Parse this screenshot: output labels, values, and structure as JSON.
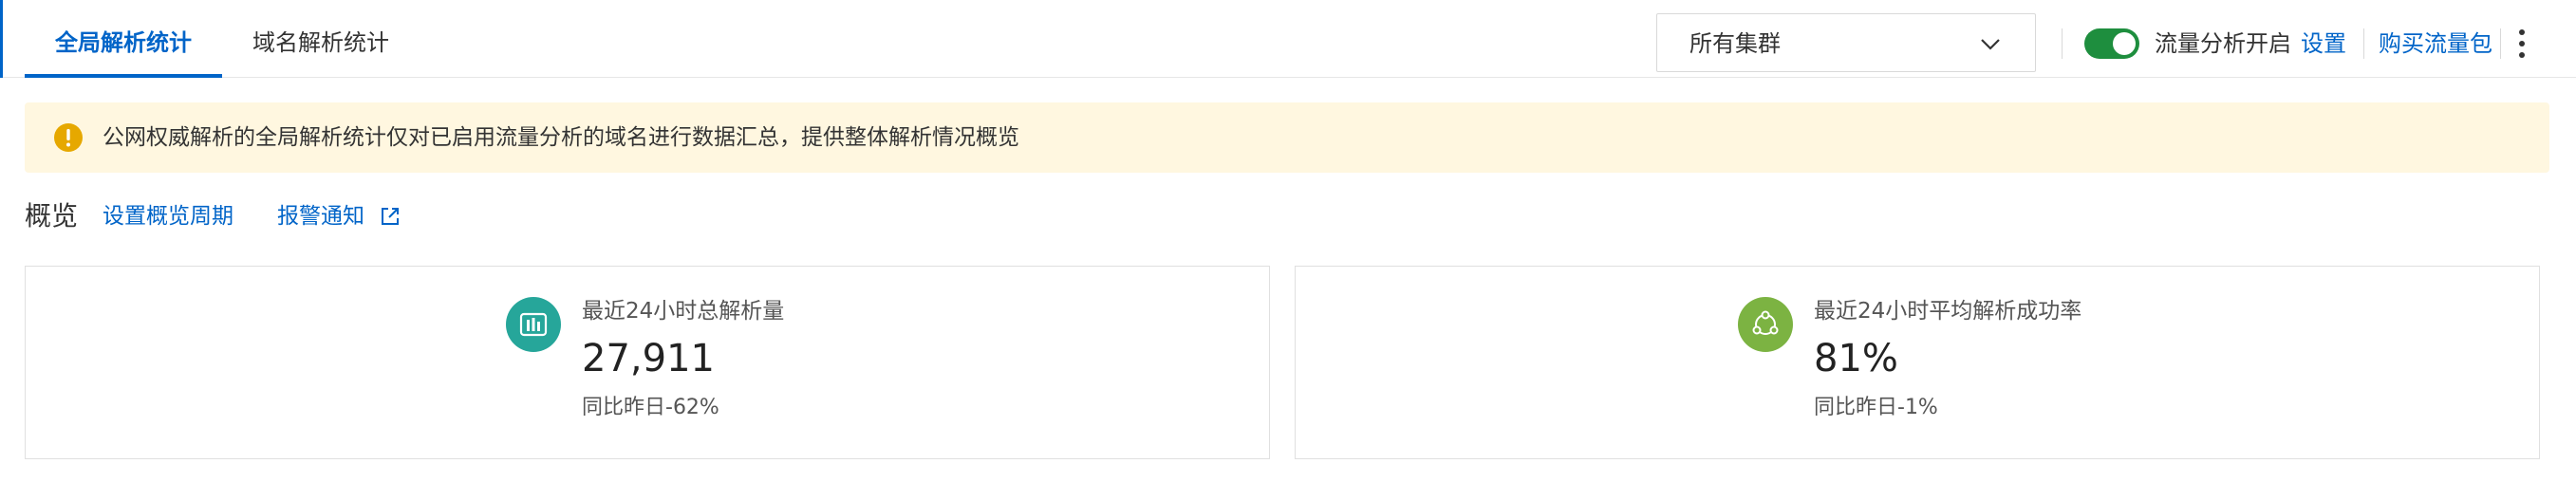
{
  "tabs": [
    {
      "label": "全局解析统计",
      "active": true
    },
    {
      "label": "域名解析统计",
      "active": false
    }
  ],
  "cluster_select": {
    "value": "所有集群"
  },
  "traffic_toggle": {
    "label": "流量分析开启",
    "on": true
  },
  "header_links": {
    "settings": "设置",
    "buy": "购买流量包"
  },
  "notice": {
    "text": "公网权威解析的全局解析统计仅对已启用流量分析的域名进行数据汇总，提供整体解析情况概览"
  },
  "overview": {
    "title": "概览",
    "period_link": "设置概览周期",
    "alert_link": "报警通知"
  },
  "cards": [
    {
      "icon": "bar-chart-icon",
      "label": "最近24小时总解析量",
      "value": "27,911",
      "compare": "同比昨日-62%"
    },
    {
      "icon": "share-nodes-icon",
      "label": "最近24小时平均解析成功率",
      "value": "81%",
      "compare": "同比昨日-1%"
    }
  ],
  "colors": {
    "accent": "#0064c8",
    "toggle_on": "#1e8e3e",
    "notice_bg": "#fff7e0",
    "warning": "#e6a800",
    "card1_icon": "#26a69a",
    "card2_icon": "#7cb342"
  }
}
